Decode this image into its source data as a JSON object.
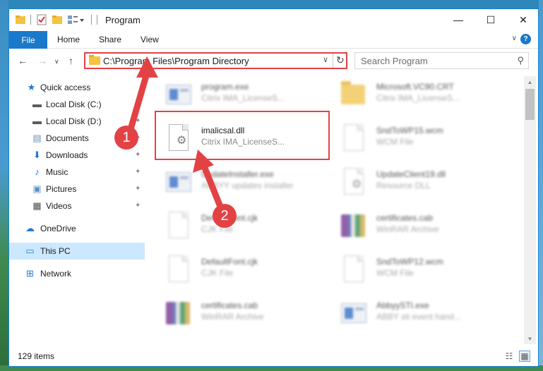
{
  "window": {
    "title": "Program",
    "minimize_glyph": "—",
    "maximize_glyph": "☐",
    "close_glyph": "✕"
  },
  "ribbon": {
    "tabs": [
      "File",
      "Home",
      "Share",
      "View"
    ],
    "expand_glyph": "∨",
    "help_glyph": "?"
  },
  "nav": {
    "back_glyph": "←",
    "forward_glyph": "→",
    "recent_glyph": "∨",
    "up_glyph": "↑",
    "address": "C:\\Program Files\\Program Directory",
    "address_dropdown_glyph": "∨",
    "refresh_glyph": "↻",
    "search_placeholder": "Search Program",
    "search_glyph": "⚲"
  },
  "sidebar": {
    "items": [
      {
        "label": "Quick access",
        "icon": "star-icon",
        "glyph": "★",
        "color": "#1e78d7",
        "pinned": false
      },
      {
        "label": "Local Disk (C:)",
        "icon": "drive-icon",
        "glyph": "▬",
        "color": "#5a5a5a",
        "pinned": true
      },
      {
        "label": "Local Disk (D:)",
        "icon": "drive-icon",
        "glyph": "▬",
        "color": "#5a5a5a",
        "pinned": true
      },
      {
        "label": "Documents",
        "icon": "documents-icon",
        "glyph": "▤",
        "color": "#6b8fb8",
        "pinned": true
      },
      {
        "label": "Downloads",
        "icon": "download-icon",
        "glyph": "⬇",
        "color": "#1e78d7",
        "pinned": true
      },
      {
        "label": "Music",
        "icon": "music-icon",
        "glyph": "♪",
        "color": "#1e78d7",
        "pinned": true
      },
      {
        "label": "Pictures",
        "icon": "pictures-icon",
        "glyph": "▣",
        "color": "#5b8fc7",
        "pinned": true
      },
      {
        "label": "Videos",
        "icon": "videos-icon",
        "glyph": "▦",
        "color": "#4a4a4a",
        "pinned": true
      },
      {
        "label": "OneDrive",
        "icon": "cloud-icon",
        "glyph": "☁",
        "color": "#1e78d7",
        "pinned": false
      },
      {
        "label": "This PC",
        "icon": "computer-icon",
        "glyph": "▭",
        "color": "#1e78d7",
        "pinned": false,
        "selected": true
      },
      {
        "label": "Network",
        "icon": "network-icon",
        "glyph": "⊞",
        "color": "#1e78d7",
        "pinned": false
      }
    ],
    "pin_glyph": "📌"
  },
  "files": [
    {
      "name": "program.exe",
      "desc": "Citrix IMA_LicenseS...",
      "icon": "app-icon",
      "blurred": true
    },
    {
      "name": "Microsoft.VC90.CRT",
      "desc": "Citrix IMA_LicenseS...",
      "icon": "folder-icon",
      "blurred": true
    },
    {
      "name": "imalicsal.dll",
      "desc": "Citrix IMA_LicenseS...",
      "icon": "dll-icon",
      "blurred": false
    },
    {
      "name": "SndToWP15.wcm",
      "desc": "WCM File",
      "icon": "file-icon",
      "blurred": true
    },
    {
      "name": "UpdateInstaller.exe",
      "desc": "ABBYY updates installer",
      "icon": "app-icon",
      "blurred": true
    },
    {
      "name": "UpdateClient19.dll",
      "desc": "Resource DLL",
      "icon": "dll-icon",
      "blurred": true
    },
    {
      "name": "DefaultFont.cjk",
      "desc": "CJK File",
      "icon": "file-icon",
      "blurred": true
    },
    {
      "name": "certificates.cab",
      "desc": "WinRAR Archive",
      "icon": "archive-icon",
      "blurred": true
    },
    {
      "name": "DefaultFont.cjk",
      "desc": "CJK File",
      "icon": "file-icon",
      "blurred": true
    },
    {
      "name": "SndToWP12.wcm",
      "desc": "WCM File",
      "icon": "file-icon",
      "blurred": true
    },
    {
      "name": "certificates.cab",
      "desc": "WinRAR Archive",
      "icon": "archive-icon",
      "blurred": true
    },
    {
      "name": "AbbyySTI.exe",
      "desc": "ABBY sti event hand...",
      "icon": "app-icon",
      "blurred": true
    }
  ],
  "status": {
    "item_count": "129 items",
    "details_view_glyph": "☷",
    "tiles_view_glyph": "▦"
  },
  "annotations": {
    "step1": "1",
    "step2": "2",
    "color": "#e34245"
  },
  "colors": {
    "accent": "#1979ca",
    "selection": "#cce8ff",
    "highlight": "#e34245"
  }
}
